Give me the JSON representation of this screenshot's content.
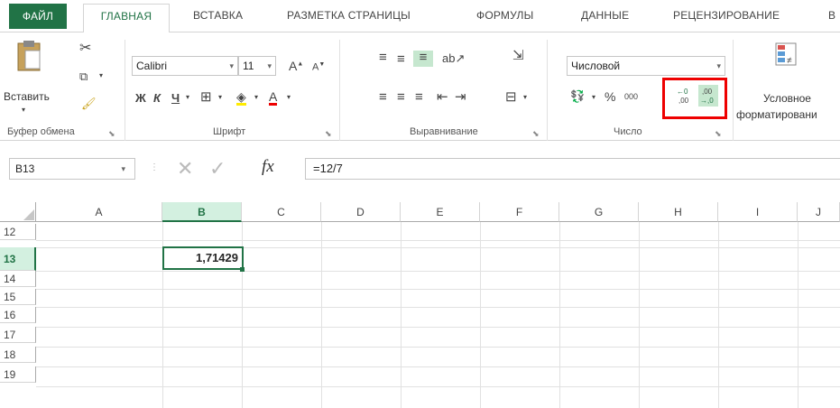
{
  "tabs": {
    "file": "ФАЙЛ",
    "home": "ГЛАВНАЯ",
    "insert": "ВСТАВКА",
    "layout": "РАЗМЕТКА СТРАНИЦЫ",
    "formulas": "ФОРМУЛЫ",
    "data": "ДАННЫЕ",
    "review": "РЕЦЕНЗИРОВАНИЕ",
    "view": "В"
  },
  "ribbon": {
    "paste_label": "Вставить",
    "clipboard_group": "Буфер обмена",
    "font_name": "Calibri",
    "font_size": "11",
    "bold": "Ж",
    "italic": "К",
    "underline": "Ч",
    "font_group": "Шрифт",
    "alignment_group": "Выравнивание",
    "number_format": "Числовой",
    "percent": "%",
    "thousands": "000",
    "number_group": "Число",
    "cond_format_line1": "Условное",
    "cond_format_line2": "форматировани"
  },
  "formula_bar": {
    "name_box": "B13",
    "fx": "fx",
    "formula": "=12/7"
  },
  "grid": {
    "columns": [
      "A",
      "B",
      "C",
      "D",
      "E",
      "F",
      "G",
      "H",
      "I",
      "J"
    ],
    "rows": [
      "12",
      "13",
      "14",
      "15",
      "16",
      "17",
      "18",
      "19"
    ],
    "b13_value": "1,71429"
  },
  "colors": {
    "accent": "#217346",
    "highlight": "#e00000"
  }
}
